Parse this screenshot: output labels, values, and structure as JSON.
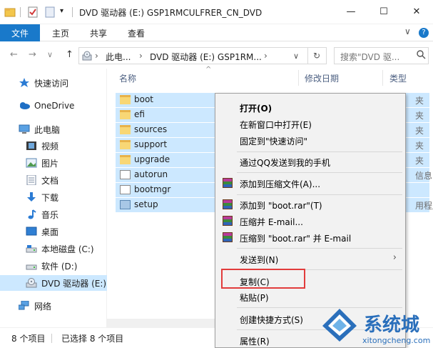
{
  "window": {
    "title": "DVD 驱动器 (E:) GSP1RMCULFRER_CN_DVD",
    "minimize": "—",
    "maximize": "☐",
    "close": "✕"
  },
  "ribbon": {
    "tabs": [
      "文件",
      "主页",
      "共享",
      "查看"
    ],
    "chevron": "∨",
    "help": "?"
  },
  "address": {
    "back": "←",
    "forward": "→",
    "recent": "∨",
    "up": "↑",
    "crumbs": [
      "此电...",
      "DVD 驱动器 (E:) GSP1RM..."
    ],
    "sep": "›",
    "dropdown": "∨",
    "refresh": "↻",
    "search_placeholder": "搜索\"DVD 驱..."
  },
  "nav": {
    "items": [
      {
        "label": "快速访问",
        "icon": "star-icon"
      },
      {
        "label": "OneDrive",
        "icon": "cloud-icon"
      },
      {
        "label": "此电脑",
        "icon": "computer-icon"
      },
      {
        "label": "视频",
        "icon": "video-icon"
      },
      {
        "label": "图片",
        "icon": "picture-icon"
      },
      {
        "label": "文档",
        "icon": "document-icon"
      },
      {
        "label": "下载",
        "icon": "download-icon"
      },
      {
        "label": "音乐",
        "icon": "music-icon"
      },
      {
        "label": "桌面",
        "icon": "desktop-icon"
      },
      {
        "label": "本地磁盘 (C:)",
        "icon": "drive-icon"
      },
      {
        "label": "软件 (D:)",
        "icon": "drive-icon"
      },
      {
        "label": "DVD 驱动器 (E:)",
        "icon": "dvd-icon"
      },
      {
        "label": "网络",
        "icon": "network-icon"
      }
    ]
  },
  "filelist": {
    "columns": [
      "名称",
      "修改日期",
      "类型"
    ],
    "sort_indicator": "^",
    "files": [
      {
        "name": "boot",
        "type": "夹",
        "icon": "folder-icon"
      },
      {
        "name": "efi",
        "type": "夹",
        "icon": "folder-icon"
      },
      {
        "name": "sources",
        "type": "夹",
        "icon": "folder-icon"
      },
      {
        "name": "support",
        "type": "夹",
        "icon": "folder-icon"
      },
      {
        "name": "upgrade",
        "type": "夹",
        "icon": "folder-icon"
      },
      {
        "name": "autorun",
        "type": "信息",
        "icon": "file-icon"
      },
      {
        "name": "bootmgr",
        "type": "",
        "icon": "file-icon"
      },
      {
        "name": "setup",
        "type": "用程序",
        "icon": "setup-icon"
      }
    ]
  },
  "status": {
    "count": "8 个项目",
    "selected": "已选择 8 个项目"
  },
  "context_menu": {
    "items": [
      {
        "label": "打开(O)",
        "bold": true
      },
      {
        "label": "在新窗口中打开(E)"
      },
      {
        "label": "固定到\"快速访问\""
      },
      {
        "label": "通过QQ发送到我的手机"
      },
      {
        "label": "添加到压缩文件(A)...",
        "icon": "winrar-icon"
      },
      {
        "label": "添加到 \"boot.rar\"(T)",
        "icon": "winrar-icon"
      },
      {
        "label": "压缩并 E-mail...",
        "icon": "winrar-icon"
      },
      {
        "label": "压缩到 \"boot.rar\" 并 E-mail",
        "icon": "winrar-icon"
      },
      {
        "label": "发送到(N)",
        "submenu": true
      },
      {
        "label": "复制(C)"
      },
      {
        "label": "粘贴(P)"
      },
      {
        "label": "创建快捷方式(S)"
      },
      {
        "label": "属性(R)"
      }
    ],
    "submenu_arrow": "›"
  },
  "watermark": {
    "name": "系统城",
    "url": "xitongcheng.com"
  },
  "colors": {
    "accent": "#1979ca",
    "selection": "#cce8ff",
    "highlight": "#e23c3c"
  }
}
